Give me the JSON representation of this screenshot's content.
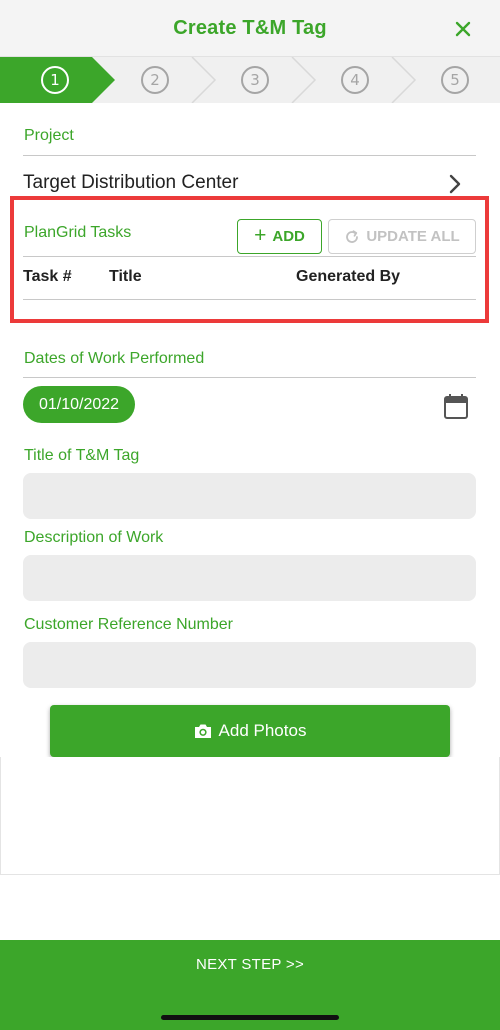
{
  "header": {
    "title": "Create T&M Tag"
  },
  "stepper": {
    "steps": [
      "1",
      "2",
      "3",
      "4",
      "5"
    ],
    "active_step": 1
  },
  "project": {
    "label": "Project",
    "value": "Target Distribution Center"
  },
  "tasks": {
    "label": "PlanGrid Tasks",
    "add_label": "ADD",
    "update_all_label": "UPDATE ALL",
    "columns": [
      "Task #",
      "Title",
      "Generated By"
    ],
    "highlight_color": "#ec3a3a"
  },
  "dates": {
    "label": "Dates of Work Performed",
    "value": "01/10/2022"
  },
  "title_field": {
    "label": "Title of T&M Tag",
    "value": ""
  },
  "description_field": {
    "label": "Description of Work",
    "value": ""
  },
  "reference_field": {
    "label": "Customer Reference Number",
    "value": ""
  },
  "photos": {
    "button_label": "Add Photos"
  },
  "footer": {
    "next_label": "NEXT STEP >>"
  },
  "colors": {
    "accent": "#3ca62a",
    "field_bg": "#ececec"
  }
}
